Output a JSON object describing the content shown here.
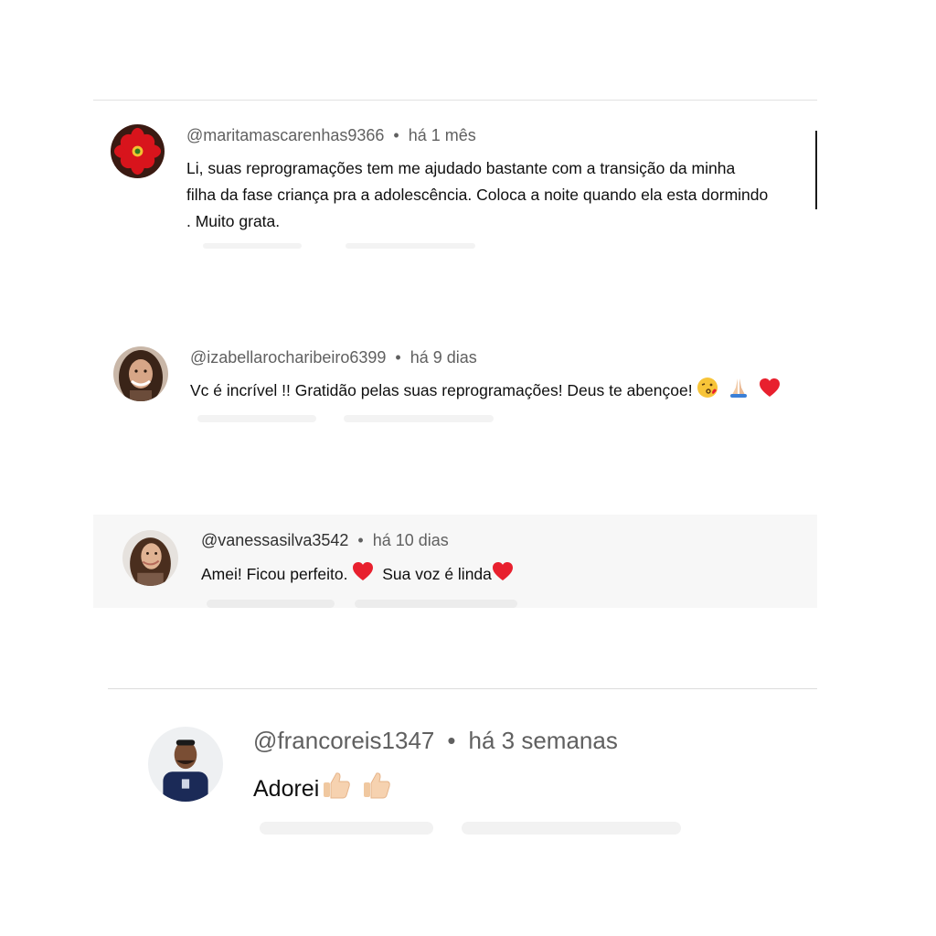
{
  "comments": [
    {
      "username": "@maritamascarenhas9366",
      "time": "há 1 mês",
      "lines": [
        "Li, suas reprogramações tem me ajudado bastante com a transição da minha",
        "filha da fase criança pra a adolescência. Coloca a noite quando ela esta dormindo",
        ". Muito grata."
      ]
    },
    {
      "username": "@izabellarocharibeiro6399",
      "time": "há 9 dias",
      "text": "Vc é incrível !! Gratidão pelas suas reprogramações! Deus te abençoe!",
      "emojis": [
        "kissing-face-emoji",
        "praying-hands-emoji",
        "red-heart-emoji"
      ]
    },
    {
      "username": "@vanessasilva3542",
      "time": "há 10 dias",
      "text_a": "Amei! Ficou perfeito.",
      "text_b": "Sua voz é linda",
      "emojis": [
        "red-heart-emoji",
        "red-heart-emoji"
      ]
    },
    {
      "username": "@francoreis1347",
      "time": "há 3 semanas",
      "text": "Adorei",
      "emojis": [
        "thumbs-up-emoji",
        "thumbs-up-emoji"
      ]
    }
  ],
  "separator": "•",
  "colors": {
    "meta": "#606060",
    "text": "#0f0f0f",
    "divider": "#e2e2e2",
    "highlight_bg": "#f7f7f7",
    "pill": "#f0f0f0",
    "heart": "#e8202e"
  }
}
